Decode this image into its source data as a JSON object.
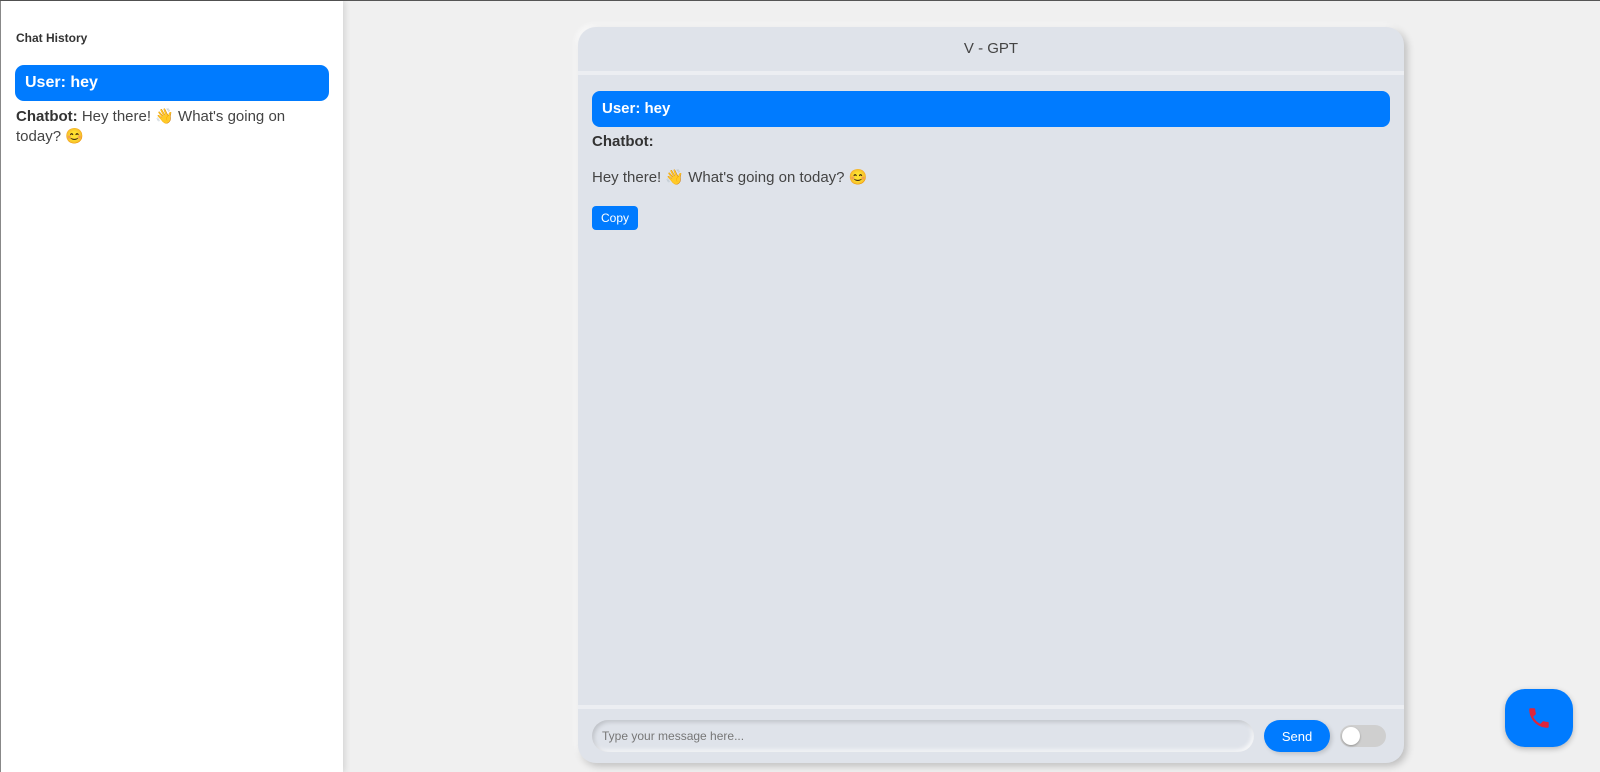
{
  "sidebar": {
    "title": "Chat History",
    "items": [
      {
        "user": "User: hey",
        "bot_label": "Chatbot:",
        "bot_text": " Hey there! 👋 What's going on today? 😊"
      }
    ]
  },
  "chat": {
    "title": "V - GPT",
    "messages": [
      {
        "user": "User: hey",
        "bot_label": "Chatbot:",
        "bot_text": "Hey there! 👋 What's going on today? 😊",
        "copy_label": "Copy"
      }
    ],
    "input_placeholder": "Type your message here...",
    "send_label": "Send",
    "toggle_on": false
  },
  "call_button": {
    "icon": "phone-hangup-icon",
    "color": "#e0243a"
  },
  "colors": {
    "accent": "#007bff",
    "panel": "#dfe3ea"
  }
}
